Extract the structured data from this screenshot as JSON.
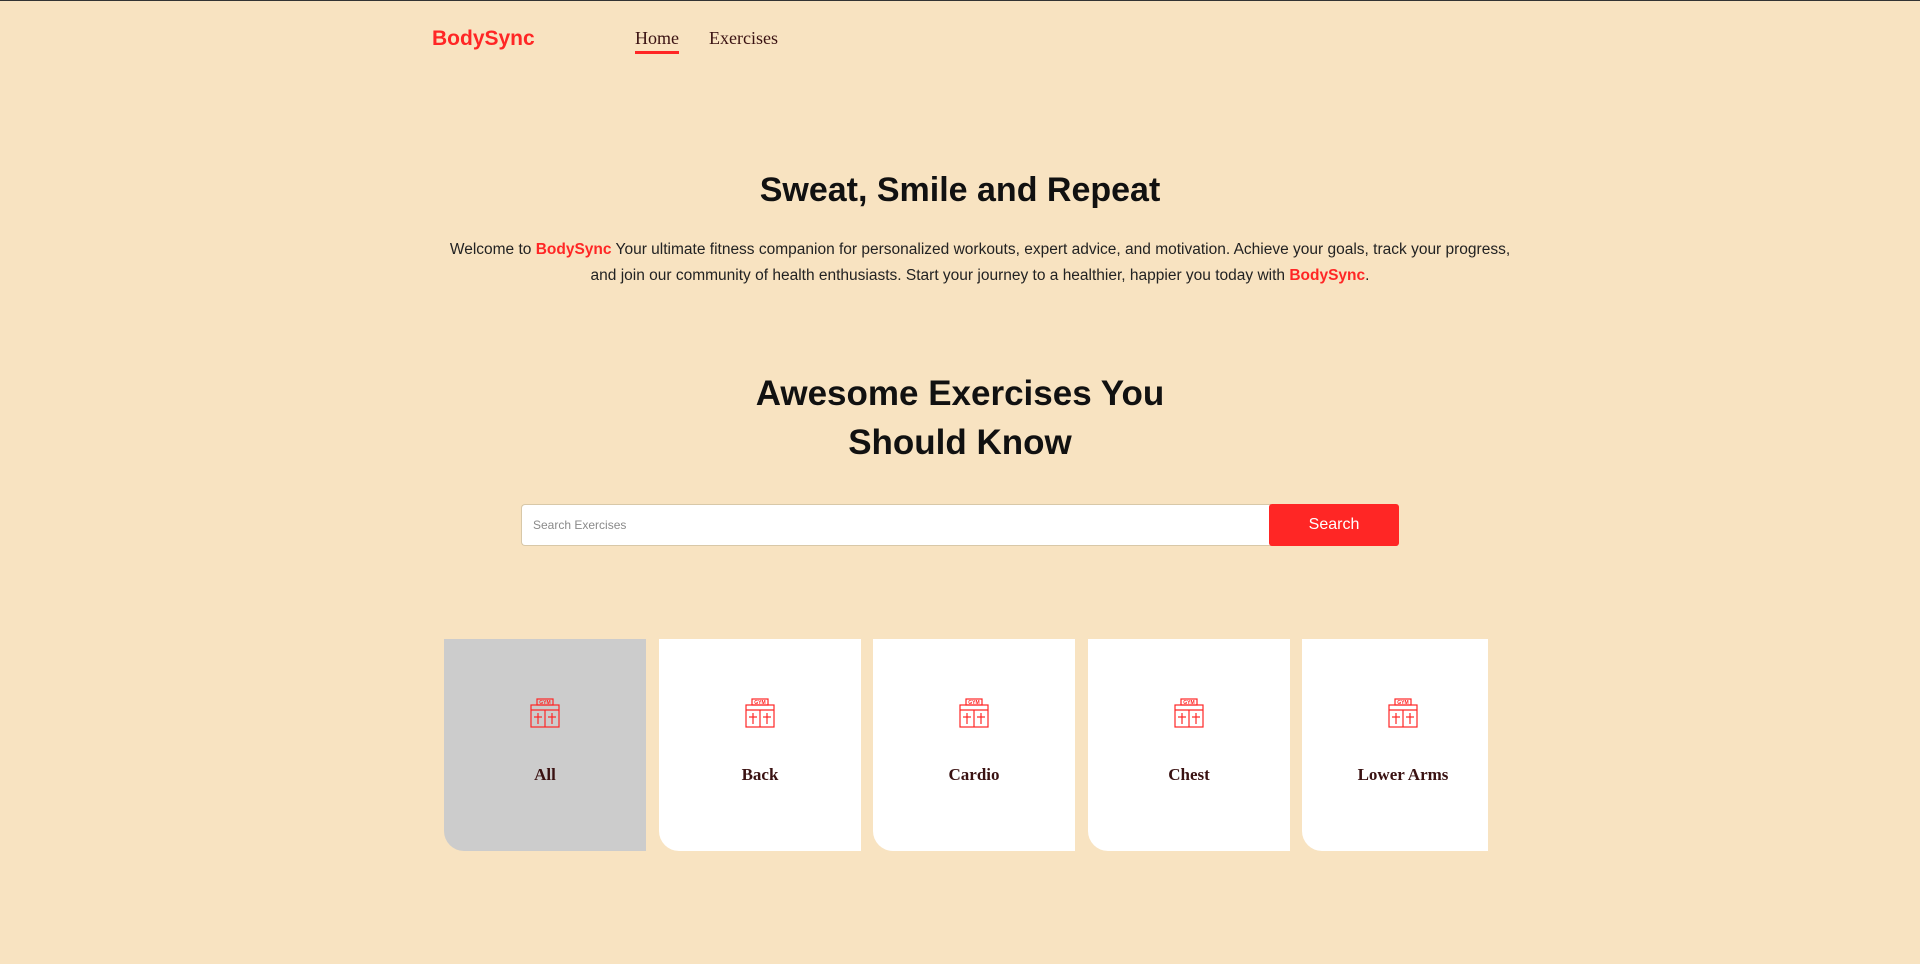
{
  "nav": {
    "logo": "BodySync",
    "links": [
      {
        "label": "Home",
        "active": true
      },
      {
        "label": "Exercises",
        "active": false
      }
    ]
  },
  "hero": {
    "title": "Sweat, Smile and Repeat",
    "text_part1": "Welcome to ",
    "brand": "BodySync",
    "text_part2": " Your ultimate fitness companion for personalized workouts, expert advice, and motivation. Achieve your goals, track your progress, and join our community of health enthusiasts. Start your journey to a healthier, happier you today with ",
    "text_part3": "."
  },
  "section": {
    "title_line1": "Awesome Exercises You",
    "title_line2": "Should Know"
  },
  "search": {
    "placeholder": "Search Exercises",
    "value": "",
    "button_label": "Search"
  },
  "categories": [
    {
      "label": "All",
      "icon": "gym-icon",
      "selected": true
    },
    {
      "label": "Back",
      "icon": "gym-icon",
      "selected": false
    },
    {
      "label": "Cardio",
      "icon": "gym-icon",
      "selected": false
    },
    {
      "label": "Chest",
      "icon": "gym-icon",
      "selected": false
    },
    {
      "label": "Lower Arms",
      "icon": "gym-icon",
      "selected": false
    }
  ],
  "colors": {
    "background": "#f8e3c1",
    "accent": "#ff2625",
    "card": "#ffffff",
    "card_selected": "#cccccc",
    "label_text": "#3a1212"
  }
}
